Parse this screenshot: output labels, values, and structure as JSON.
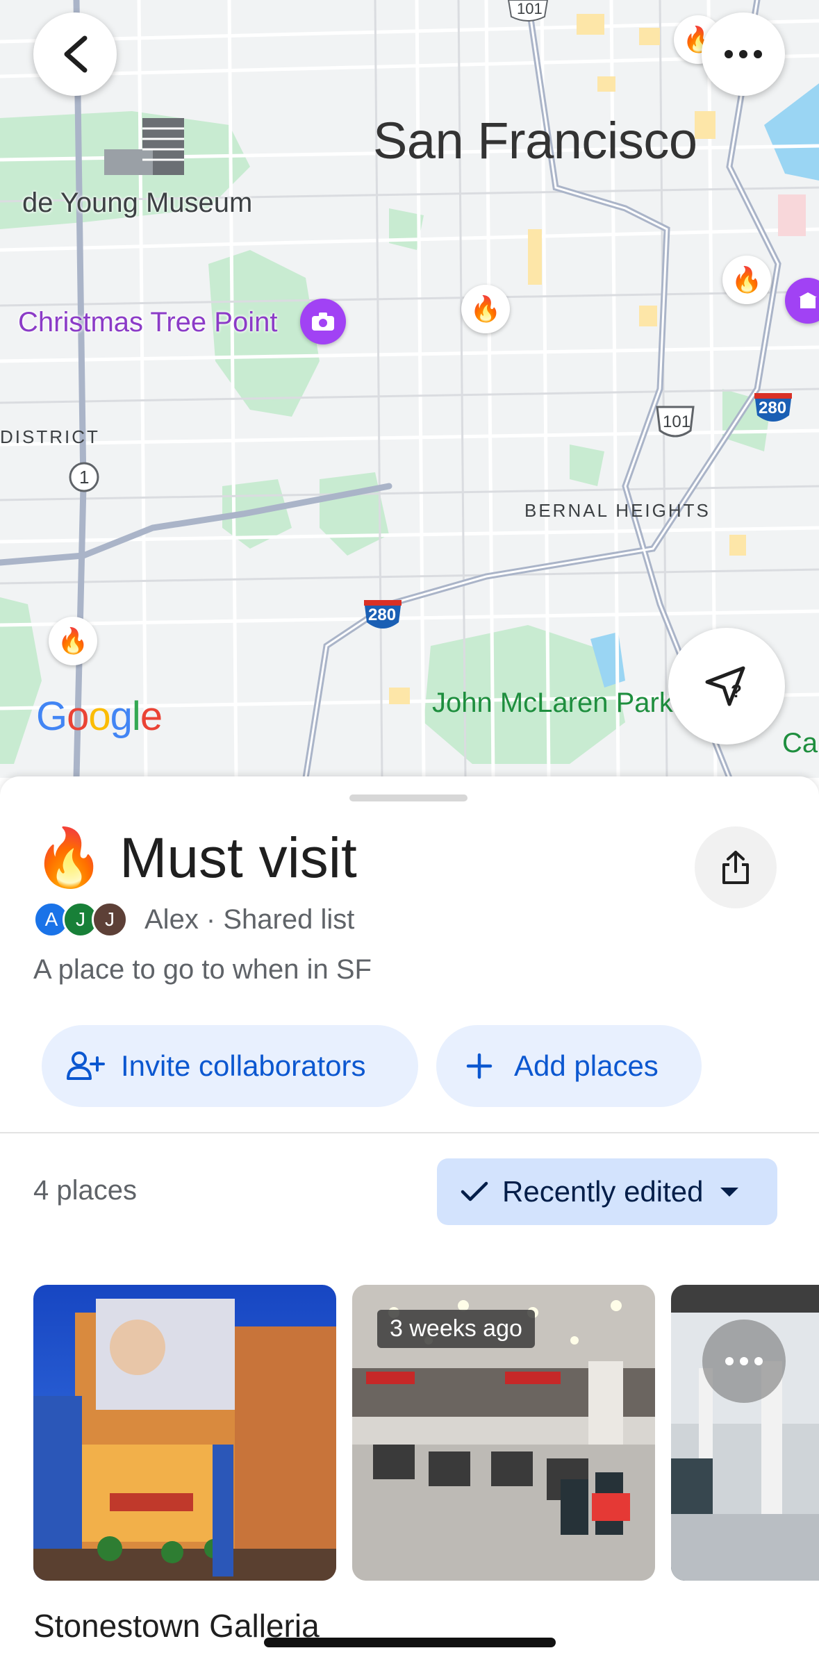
{
  "map": {
    "city_label": "San Francisco",
    "museum_label": "de Young Museum",
    "poi_label": "Christmas Tree Point",
    "district_label": "DISTRICT",
    "neighborhood_label": "BERNAL HEIGHTS",
    "park_label": "John McLaren Park",
    "edge_label": "Ca",
    "google_logo": [
      "G",
      "o",
      "o",
      "g",
      "l",
      "e"
    ],
    "google_colors": [
      "#4285F4",
      "#EA4335",
      "#FBBC05",
      "#4285F4",
      "#34A853",
      "#EA4335"
    ],
    "route_shields": [
      "101",
      "101",
      "1",
      "280",
      "280"
    ],
    "pin_emoji": "🔥",
    "back_icon": "chevron-left-icon",
    "more_icon": "more-horizontal-icon",
    "nav_icon": "navigation-question-icon"
  },
  "list": {
    "emoji": "🔥",
    "title": "Must visit",
    "owner": "Alex · Shared list",
    "avatars": [
      {
        "letter": "A",
        "color": "#1a73e8"
      },
      {
        "letter": "J",
        "color": "#188038"
      },
      {
        "letter": "J",
        "color": "#5d4037"
      }
    ],
    "description": "A place to go to when in SF",
    "share_icon": "share-icon"
  },
  "actions": {
    "invite_label": "Invite collaborators",
    "add_label": "Add places"
  },
  "places": {
    "count": "4 places",
    "sort_label": "Recently edited",
    "photo_badge": "3 weeks ago",
    "first_place_name": "Stonestown Galleria"
  },
  "colors": {
    "accent": "#0b57d0",
    "pill_bg": "#e8f0fe",
    "sort_bg": "#d3e3fd"
  }
}
